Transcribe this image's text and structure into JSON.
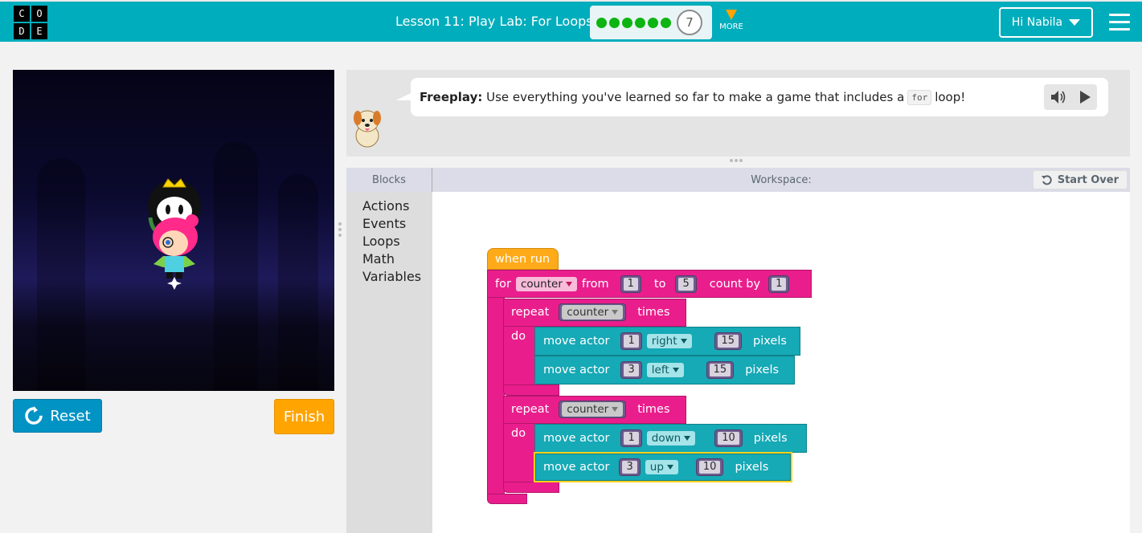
{
  "header": {
    "logo_letters": [
      "C",
      "O",
      "D",
      "E"
    ],
    "lesson_title": "Lesson 11: Play Lab: For Loops",
    "progress_dots": 6,
    "current_level": "7",
    "more_label": "MORE",
    "user_label": "Hi Nabila"
  },
  "game": {
    "reset_label": "Reset",
    "finish_label": "Finish"
  },
  "instructions": {
    "prefix": "Freeplay:",
    "text_before": "Use everything you've learned so far to make a game that includes a",
    "code_word": "for",
    "text_after": "loop!"
  },
  "workspace": {
    "toolbox_title": "Blocks",
    "workspace_title": "Workspace:",
    "start_over_label": "Start Over",
    "categories": [
      "Actions",
      "Events",
      "Loops",
      "Math",
      "Variables"
    ]
  },
  "blocks": {
    "when_run": "when run",
    "for_block": {
      "for": "for",
      "var": "counter",
      "from": "from",
      "start": "1",
      "to": "to",
      "end": "5",
      "count_by": "count by",
      "step": "1"
    },
    "repeat1": {
      "repeat": "repeat",
      "var": "counter",
      "times": "times",
      "do": "do"
    },
    "move1": {
      "label": "move actor",
      "actor": "1",
      "dir": "right",
      "dist": "15",
      "unit": "pixels"
    },
    "move2": {
      "label": "move actor",
      "actor": "3",
      "dir": "left",
      "dist": "15",
      "unit": "pixels"
    },
    "repeat2": {
      "repeat": "repeat",
      "var": "counter",
      "times": "times",
      "do": "do"
    },
    "move3": {
      "label": "move actor",
      "actor": "1",
      "dir": "down",
      "dist": "10",
      "unit": "pixels"
    },
    "move4": {
      "label": "move actor",
      "actor": "3",
      "dir": "up",
      "dist": "10",
      "unit": "pixels"
    }
  },
  "colors": {
    "header": "#00adbc",
    "loop_block": "#e91e8c",
    "action_block": "#16a9b6",
    "event_block": "#ffab19",
    "reset": "#0093c4",
    "finish": "#ffa400"
  }
}
